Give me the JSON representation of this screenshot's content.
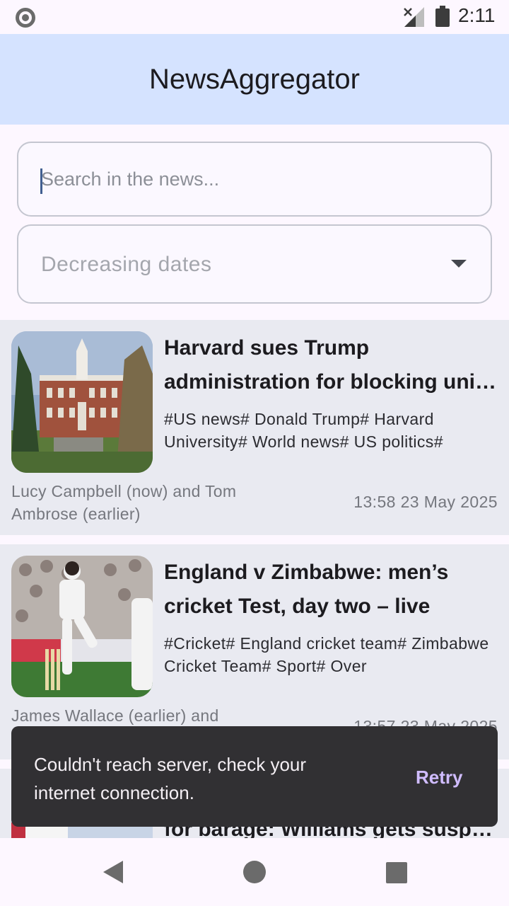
{
  "status_bar": {
    "time": "2:11"
  },
  "app_bar": {
    "title": "NewsAggregator"
  },
  "search": {
    "placeholder": "Search in the news..."
  },
  "sort": {
    "selected": "Decreasing dates"
  },
  "articles": [
    {
      "title_line1": "Harvard sues Trump",
      "title_line2": "administration for blocking uni…",
      "tags": "#US news# Donald Trump# Harvard University# World news# US politics#",
      "authors": "Lucy Campbell (now) and Tom Ambrose (earlier)",
      "date": "13:58 23 May 2025"
    },
    {
      "title_line1": "England v Zimbabwe: men’s",
      "title_line2": "cricket Test, day two – live",
      "tags": "#Cricket# England cricket team# Zimbabwe Cricket Team# Sport# Over",
      "authors": "James Wallace (earlier) and",
      "date": "13:57 23 May 2025"
    },
    {
      "title_line1": "for barage: Williams gets susp…"
    }
  ],
  "snackbar": {
    "message": "Couldn't reach server, check your internet connection.",
    "action": "Retry"
  },
  "colors": {
    "app_bar": "#d5e3ff",
    "card": "#e9eaf1",
    "snackbar": "#313033",
    "snackbar_action": "#d0bcff"
  }
}
